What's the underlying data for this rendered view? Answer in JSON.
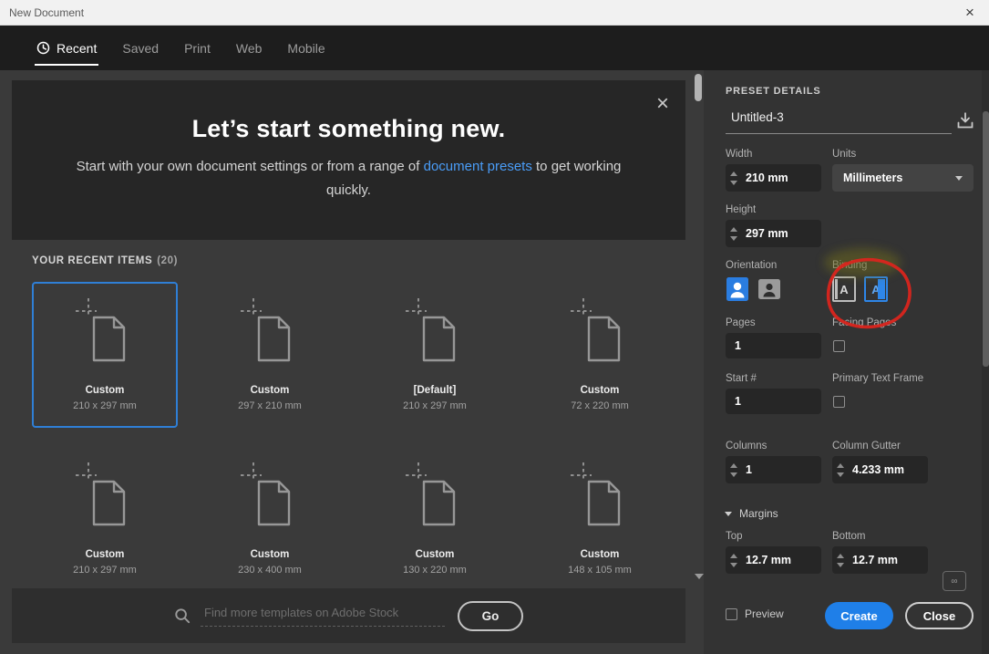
{
  "window": {
    "title": "New Document",
    "close_glyph": "×"
  },
  "tabs": [
    {
      "label": "Recent"
    },
    {
      "label": "Saved"
    },
    {
      "label": "Print"
    },
    {
      "label": "Web"
    },
    {
      "label": "Mobile"
    }
  ],
  "hero": {
    "close_glyph": "×",
    "title": "Let’s start something new.",
    "subtitle_pre": "Start with your own document settings or from a range of ",
    "subtitle_link": "document presets",
    "subtitle_post": " to get working quickly."
  },
  "recent": {
    "heading": "YOUR RECENT ITEMS",
    "count": "(20)",
    "items": [
      {
        "name": "Custom",
        "dims": "210 x 297 mm",
        "selected": true
      },
      {
        "name": "Custom",
        "dims": "297 x 210 mm",
        "selected": false
      },
      {
        "name": "[Default]",
        "dims": "210 x 297 mm",
        "selected": false
      },
      {
        "name": "Custom",
        "dims": "72 x 220 mm",
        "selected": false
      },
      {
        "name": "Custom",
        "dims": "210 x 297 mm",
        "selected": false
      },
      {
        "name": "Custom",
        "dims": "230 x 400 mm",
        "selected": false
      },
      {
        "name": "Custom",
        "dims": "130 x 220 mm",
        "selected": false
      },
      {
        "name": "Custom",
        "dims": "148 x 105 mm",
        "selected": false
      }
    ]
  },
  "search": {
    "placeholder": "Find more templates on Adobe Stock",
    "go_label": "Go"
  },
  "preset": {
    "heading": "PRESET DETAILS",
    "doc_name": "Untitled-3",
    "width_label": "Width",
    "width_value": "210 mm",
    "units_label": "Units",
    "units_value": "Millimeters",
    "height_label": "Height",
    "height_value": "297 mm",
    "orientation_label": "Orientation",
    "binding_label": "Binding",
    "binding_glyph": "A",
    "pages_label": "Pages",
    "pages_value": "1",
    "facing_pages_label": "Facing Pages",
    "start_label": "Start #",
    "start_value": "1",
    "primary_text_frame_label": "Primary Text Frame",
    "columns_label": "Columns",
    "columns_value": "1",
    "column_gutter_label": "Column Gutter",
    "column_gutter_value": "4.233 mm",
    "margins_label": "Margins",
    "top_label": "Top",
    "top_value": "12.7 mm",
    "bottom_label": "Bottom",
    "bottom_value": "12.7 mm",
    "preview_label": "Preview",
    "create_label": "Create",
    "close_label": "Close"
  },
  "colors": {
    "accent_blue": "#1f7fe8",
    "link_blue": "#4a9df8",
    "annotation_red": "#da251d",
    "selected_border": "#2f7fd6"
  }
}
